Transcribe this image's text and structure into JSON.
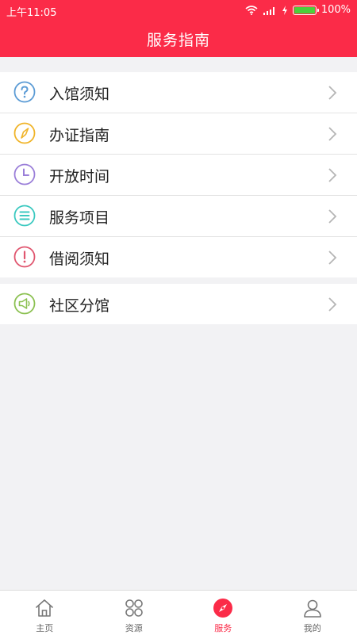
{
  "status_bar": {
    "time": "上午11:05",
    "battery": "100%"
  },
  "header": {
    "title": "服务指南"
  },
  "menu_groups": [
    {
      "items": [
        {
          "label": "入馆须知",
          "icon": "question-icon",
          "color": "#5b9bd5"
        },
        {
          "label": "办证指南",
          "icon": "compass-icon",
          "color": "#f0b429"
        },
        {
          "label": "开放时间",
          "icon": "clock-icon",
          "color": "#9b7fd9"
        },
        {
          "label": "服务项目",
          "icon": "list-icon",
          "color": "#3bc9c0"
        },
        {
          "label": "借阅须知",
          "icon": "exclamation-icon",
          "color": "#e0566f"
        }
      ]
    },
    {
      "items": [
        {
          "label": "社区分馆",
          "icon": "megaphone-icon",
          "color": "#8cc152"
        }
      ]
    }
  ],
  "tabbar": {
    "tabs": [
      {
        "label": "主页",
        "icon": "home-icon",
        "active": false
      },
      {
        "label": "资源",
        "icon": "grid-icon",
        "active": false
      },
      {
        "label": "服务",
        "icon": "compass-icon",
        "active": true
      },
      {
        "label": "我的",
        "icon": "user-icon",
        "active": false
      }
    ]
  },
  "colors": {
    "accent": "#fb2b48",
    "background": "#f2f2f4"
  }
}
